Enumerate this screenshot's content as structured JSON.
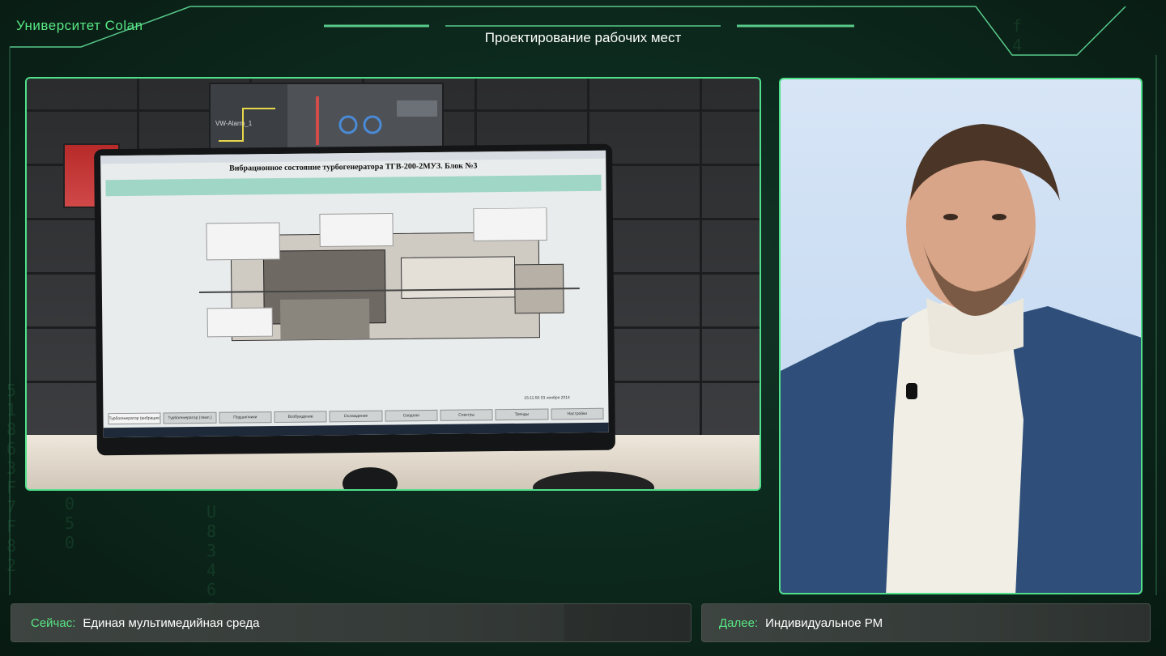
{
  "brand": "Университет Colan",
  "header": {
    "title": "Проектирование рабочих мест"
  },
  "left_panel": {
    "scada_title": "Вибрационное состояние турбогенератора ТГВ-200-2МУЗ. Блок №3",
    "wall_screen_tag": "VW-Alarm_1",
    "tabs": [
      "Турбогенератор (вибрация)",
      "Турбогенератор (темп.)",
      "Подшипники",
      "Возбуждение",
      "Охлаждение",
      "Сводная",
      "Спектры",
      "Тренды",
      "Настройки"
    ],
    "timestamp": "15:11:50    03 ноября 2014"
  },
  "footer": {
    "now_label": "Сейчас:",
    "now_value": "Единая мультимедийная среда",
    "next_label": "Далее:",
    "next_value": "Индивидуальное РМ"
  },
  "colors": {
    "accent": "#59e884",
    "frame": "#4fe08a"
  }
}
